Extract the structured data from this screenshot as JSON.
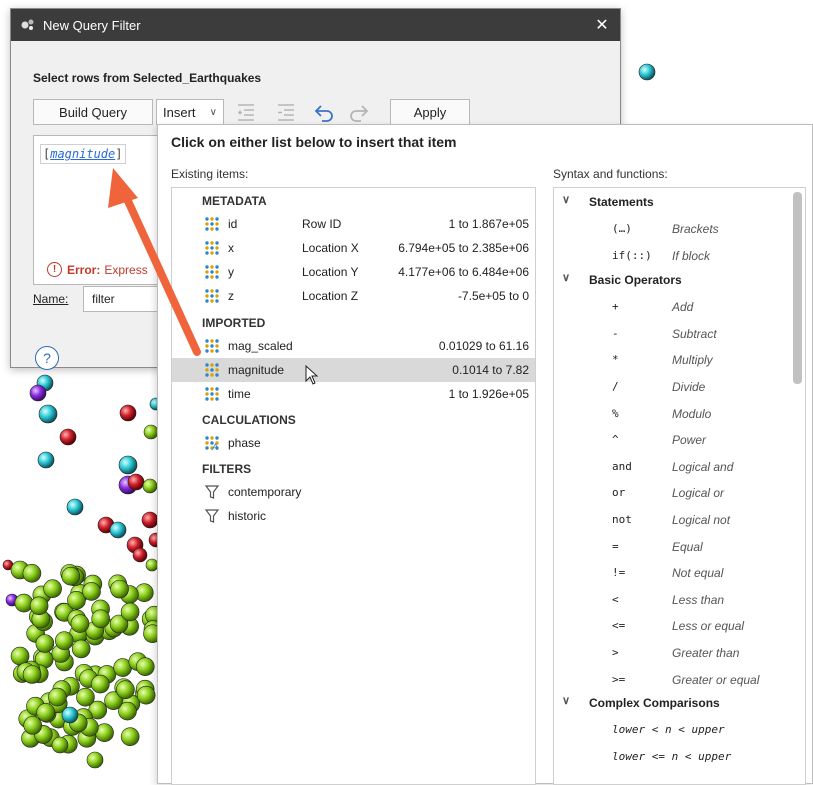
{
  "dialog": {
    "title": "New Query Filter",
    "close": "✕",
    "caption": "Select rows from Selected_Earthquakes",
    "build_query": "Build Query",
    "insert": "Insert",
    "apply": "Apply",
    "expression": {
      "open": "[",
      "field": "magnitude",
      "close": "]"
    },
    "error_label": "Error:",
    "error_text": "Express",
    "name_label": "Name:",
    "name_value": "filter",
    "help": "?"
  },
  "popup": {
    "title": "Click on either list below to insert that item",
    "existing_label": "Existing items:",
    "syntax_label": "Syntax and functions:",
    "sections": {
      "metadata": "METADATA",
      "imported": "IMPORTED",
      "calculations": "CALCULATIONS",
      "filters": "FILTERS"
    },
    "metadata_items": [
      {
        "name": "id",
        "desc": "Row ID",
        "range": "1 to 1.867e+05"
      },
      {
        "name": "x",
        "desc": "Location X",
        "range": "6.794e+05 to 2.385e+06"
      },
      {
        "name": "y",
        "desc": "Location Y",
        "range": "4.177e+06 to 6.484e+06"
      },
      {
        "name": "z",
        "desc": "Location Z",
        "range": "-7.5e+05 to 0"
      }
    ],
    "imported_items": [
      {
        "name": "mag_scaled",
        "range": "0.01029 to 61.16"
      },
      {
        "name": "magnitude",
        "range": "0.1014 to 7.82"
      },
      {
        "name": "time",
        "range": "1 to 1.926e+05"
      }
    ],
    "calculation_items": [
      {
        "name": "phase"
      }
    ],
    "filter_items": [
      {
        "name": "contemporary"
      },
      {
        "name": "historic"
      }
    ],
    "syntax": {
      "statements_label": "Statements",
      "statements": [
        {
          "sym": "(…)",
          "fn": "Brackets"
        },
        {
          "sym": "if(::)",
          "fn": "If block"
        }
      ],
      "basic_label": "Basic Operators",
      "basic": [
        {
          "sym": "+",
          "fn": "Add"
        },
        {
          "sym": "-",
          "fn": "Subtract"
        },
        {
          "sym": "*",
          "fn": "Multiply"
        },
        {
          "sym": "/",
          "fn": "Divide"
        },
        {
          "sym": "%",
          "fn": "Modulo"
        },
        {
          "sym": "^",
          "fn": "Power"
        },
        {
          "sym": "and",
          "fn": "Logical and"
        },
        {
          "sym": "or",
          "fn": "Logical or"
        },
        {
          "sym": "not",
          "fn": "Logical not"
        },
        {
          "sym": "=",
          "fn": "Equal"
        },
        {
          "sym": "!=",
          "fn": "Not equal"
        },
        {
          "sym": "<",
          "fn": "Less than"
        },
        {
          "sym": "<=",
          "fn": "Less or equal"
        },
        {
          "sym": ">",
          "fn": "Greater than"
        },
        {
          "sym": ">=",
          "fn": "Greater or equal"
        }
      ],
      "complex_label": "Complex Comparisons",
      "complex": [
        {
          "text": "lower < n < upper"
        },
        {
          "text": "lower <= n < upper"
        }
      ],
      "chevron": "∨"
    }
  },
  "colors": {
    "titlebar": "#3c3c3c",
    "field_blue": "#2a6ad8",
    "error_red": "#c0392b",
    "arrow": "#f0643c",
    "selected_row": "#d9d9d9",
    "sphere_green": "#8ed01e",
    "sphere_cyan": "#2cc9d6",
    "sphere_red": "#d0202a",
    "sphere_purple": "#8a2be2"
  }
}
